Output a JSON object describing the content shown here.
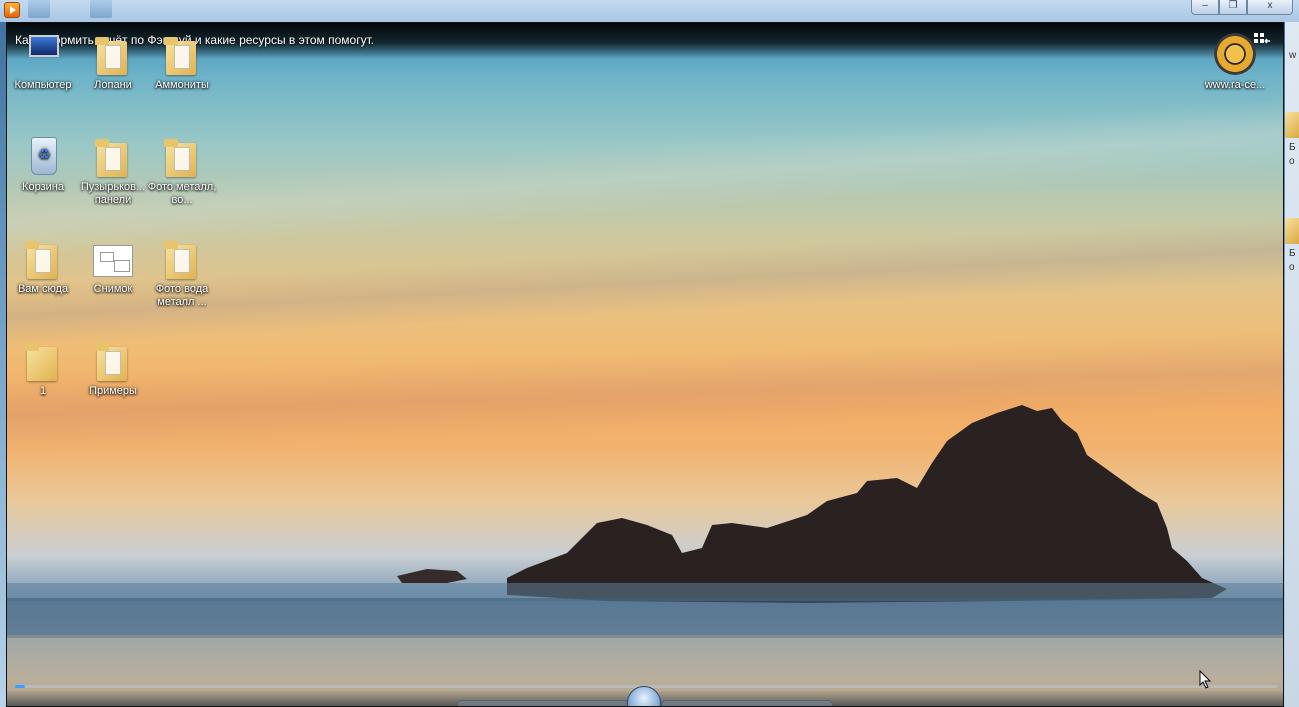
{
  "window": {
    "controls": [
      "–",
      "❐",
      "x"
    ]
  },
  "video": {
    "title": "Как оформить отчёт по Фэншуй и какие ресурсы в этом помогут.",
    "progress": 0.008
  },
  "desktop_icons": [
    {
      "label": "Компьютер",
      "icon": "computer-icon"
    },
    {
      "label": "Лопани",
      "icon": "folder-icon"
    },
    {
      "label": "Аммониты",
      "icon": "folder-icon"
    },
    {
      "label": "Корзина",
      "icon": "recycle-bin-icon"
    },
    {
      "label": "Пузырьков... панели",
      "icon": "folder-icon"
    },
    {
      "label": "Фото металл, во...",
      "icon": "folder-icon"
    },
    {
      "label": "Вам сюда",
      "icon": "folder-icon"
    },
    {
      "label": "Снимок",
      "icon": "image-icon"
    },
    {
      "label": "Фото вода металл ...",
      "icon": "folder-icon"
    },
    {
      "label": "1",
      "icon": "folder-icon"
    },
    {
      "label": "Примеры",
      "icon": "folder-icon"
    },
    {
      "label": "www.ra-ce...",
      "icon": "sun-logo-icon"
    }
  ],
  "right_strip_text": [
    "w",
    "Б",
    "о",
    "Б",
    "о"
  ],
  "colors": {
    "seek_progress": "#3aa0ff",
    "title_text": "#ffffff"
  }
}
